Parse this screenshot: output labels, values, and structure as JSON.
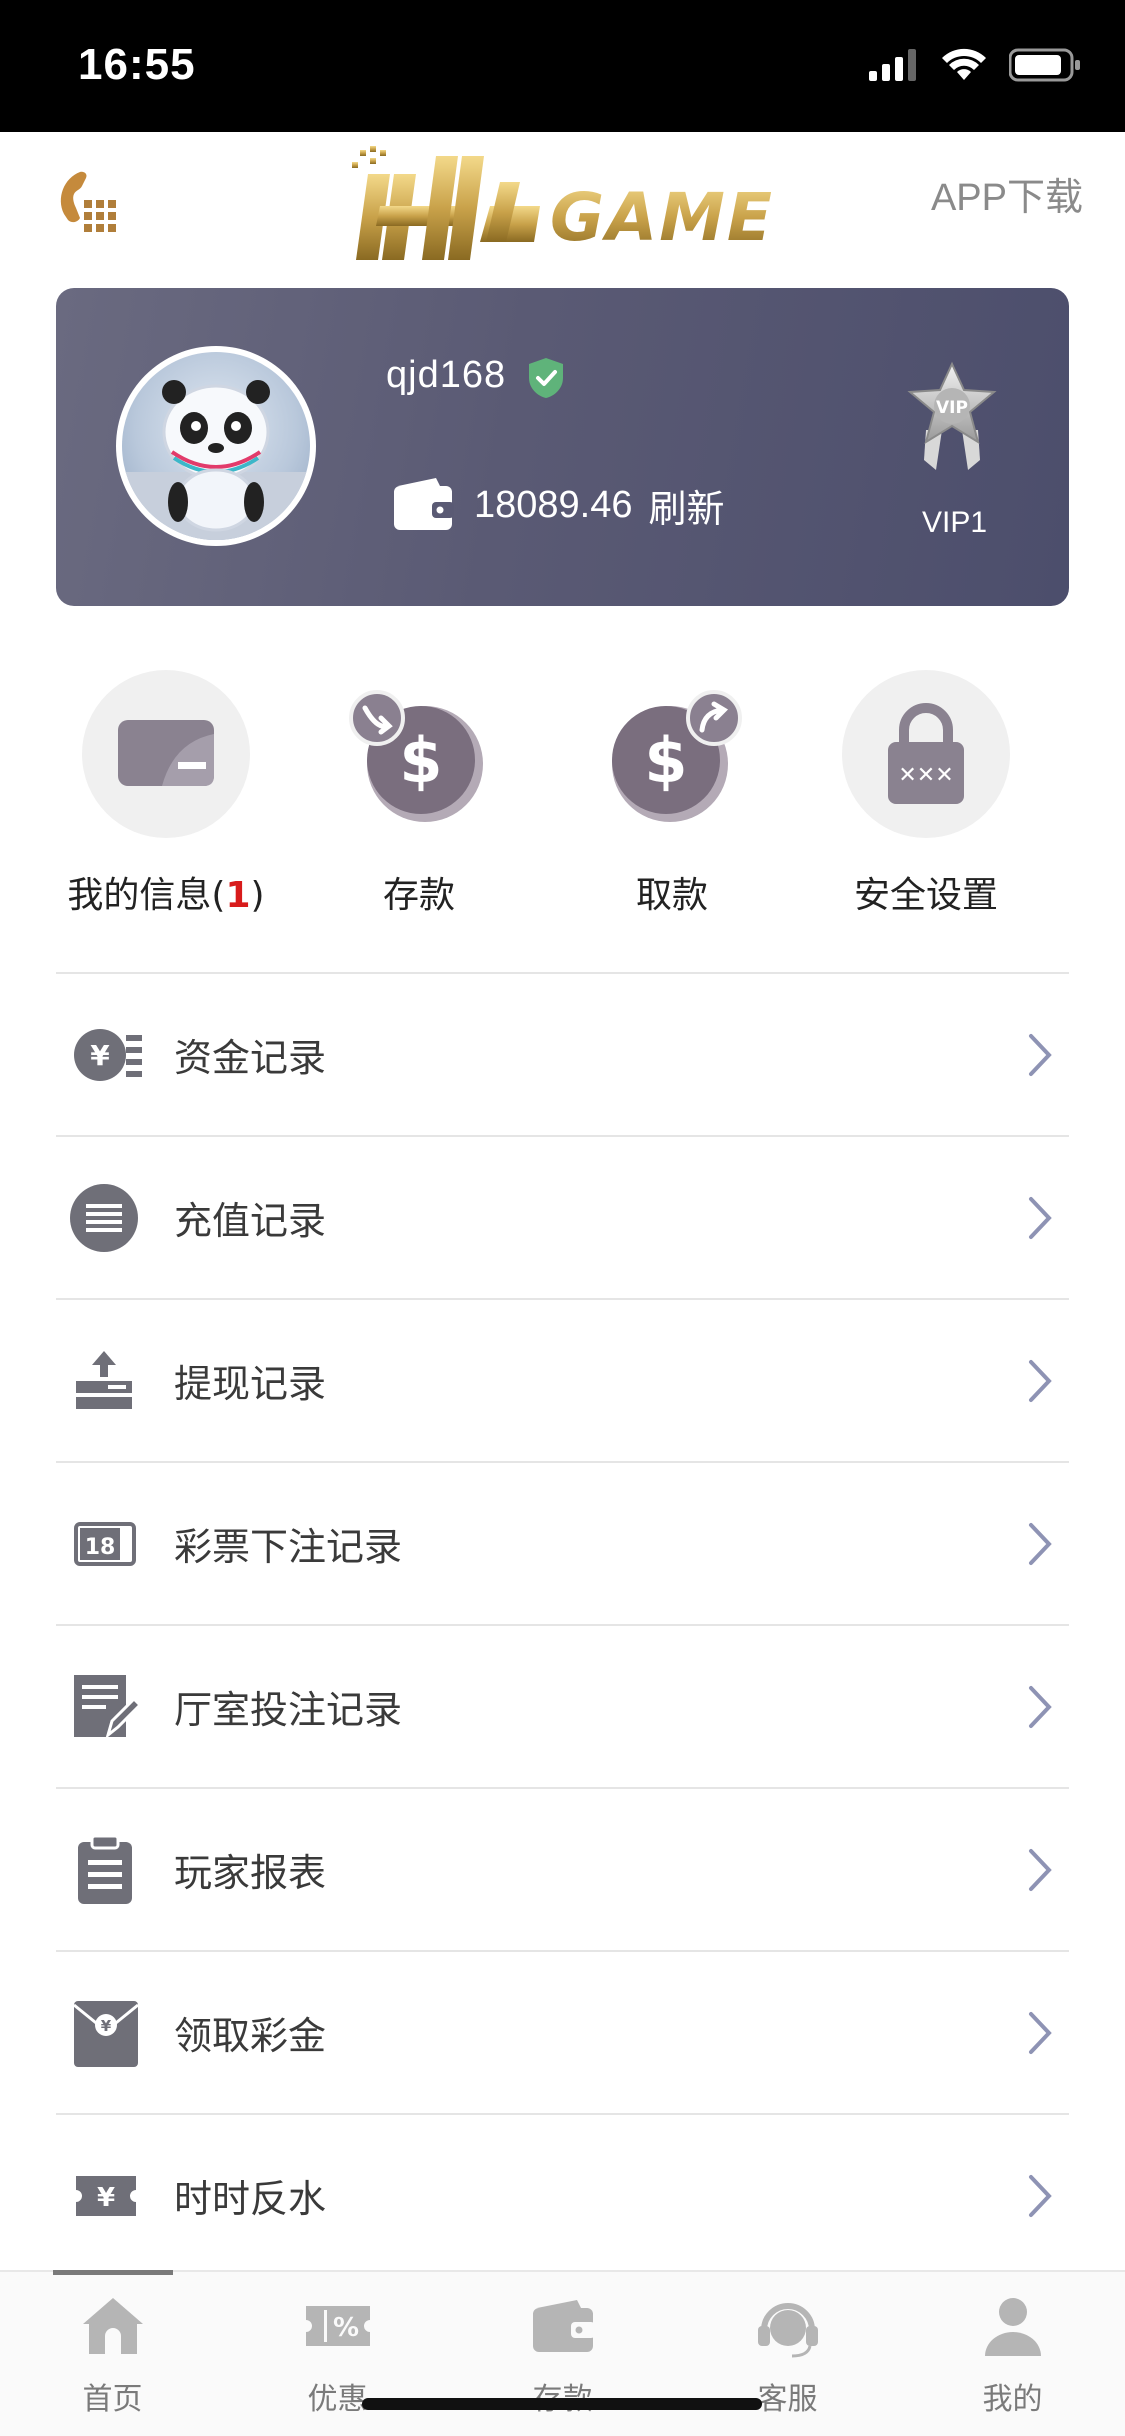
{
  "status_bar": {
    "time": "16:55"
  },
  "header": {
    "logo_text": "HH GAME",
    "app_download": "APP下载"
  },
  "profile": {
    "username": "qjd168",
    "balance": "18089.46",
    "refresh_label": "刷新",
    "vip_level": "VIP1",
    "vip_badge_text": "VIP"
  },
  "actions": [
    {
      "label": "我的信息(",
      "count": "1",
      "suffix": ")"
    },
    {
      "label": "存款"
    },
    {
      "label": "取款"
    },
    {
      "label": "安全设置"
    }
  ],
  "menu": [
    {
      "label": "资金记录",
      "icon": "yen-coin-icon"
    },
    {
      "label": "充值记录",
      "icon": "list-circle-icon"
    },
    {
      "label": "提现记录",
      "icon": "upload-tray-icon"
    },
    {
      "label": "彩票下注记录",
      "icon": "lottery-ticket-icon"
    },
    {
      "label": "厅室投注记录",
      "icon": "edit-note-icon"
    },
    {
      "label": "玩家报表",
      "icon": "clipboard-icon"
    },
    {
      "label": "领取彩金",
      "icon": "red-envelope-icon"
    },
    {
      "label": "时时反水",
      "icon": "yen-ticket-icon"
    }
  ],
  "tabs": [
    {
      "label": "首页",
      "icon": "home-icon"
    },
    {
      "label": "优惠",
      "icon": "coupon-icon"
    },
    {
      "label": "存款",
      "icon": "wallet-icon"
    },
    {
      "label": "客服",
      "icon": "headset-icon"
    },
    {
      "label": "我的",
      "icon": "user-icon"
    }
  ],
  "colors": {
    "card_gradient_start": "#6a6a80",
    "card_gradient_end": "#4c4e6c",
    "logo_gold": "#c9a24a",
    "badge_red": "#d81b1b",
    "chevron": "#8e93b4"
  }
}
